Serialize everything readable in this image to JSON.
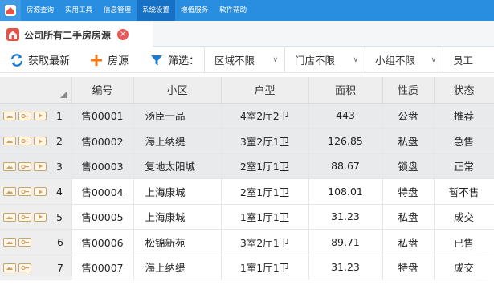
{
  "menubar": {
    "items": [
      "房源查询",
      "实用工具",
      "信息管理",
      "系统设置",
      "增值服务",
      "软件帮助"
    ],
    "active_index": 3,
    "color": "#2a8ee0"
  },
  "tab": {
    "title": "公司所有二手房房源",
    "close_symbol": "×"
  },
  "toolbar": {
    "refresh_label": "获取最新",
    "add_label": "房源",
    "filter_label": "筛选：",
    "selects": [
      "区域不限",
      "门店不限",
      "小组不限",
      "员工"
    ]
  },
  "table": {
    "columns": [
      "编号",
      "小区",
      "户型",
      "面积",
      "性质",
      "状态"
    ],
    "rows": [
      {
        "num": "1",
        "id": "售00001",
        "community": "汤臣一品",
        "layout": "4室2厅2卫",
        "area": "443",
        "type": "公盘",
        "status": "推荐"
      },
      {
        "num": "2",
        "id": "售00002",
        "community": "海上纳缇",
        "layout": "3室2厅1卫",
        "area": "126.85",
        "type": "私盘",
        "status": "急售"
      },
      {
        "num": "3",
        "id": "售00003",
        "community": "复地太阳城",
        "layout": "2室1厅1卫",
        "area": "88.67",
        "type": "锁盘",
        "status": "正常"
      },
      {
        "num": "4",
        "id": "售00004",
        "community": "上海康城",
        "layout": "2室1厅1卫",
        "area": "108.01",
        "type": "特盘",
        "status": "暂不售"
      },
      {
        "num": "5",
        "id": "售00005",
        "community": "上海康城",
        "layout": "1室1厅1卫",
        "area": "31.23",
        "type": "私盘",
        "status": "成交"
      },
      {
        "num": "6",
        "id": "售00006",
        "community": "松锦新苑",
        "layout": "3室2厅1卫",
        "area": "89.71",
        "type": "私盘",
        "status": "已售"
      },
      {
        "num": "7",
        "id": "售00007",
        "community": "海上纳缇",
        "layout": "1室1厅1卫",
        "area": "31.23",
        "type": "特盘",
        "status": "成交"
      }
    ]
  },
  "colors": {
    "accent": "#2a8ee0",
    "status_red": "#e8533c",
    "add_orange": "#f07a1a"
  }
}
